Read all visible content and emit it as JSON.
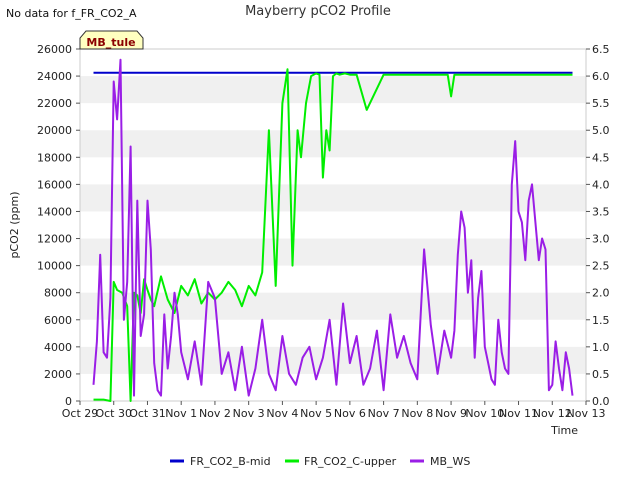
{
  "nodata_text": "No data for f_FR_CO2_A",
  "site_badge": "MB_tule",
  "colors": {
    "band": "#f0f0f0",
    "badge_fill": "#ffffc0",
    "badge_stroke": "#333333",
    "blue": "#0000cc",
    "green": "#00ee00",
    "purple": "#9a1ee6"
  },
  "chart_data": {
    "type": "line",
    "title": "Mayberry pCO2 Profile",
    "xlabel": "Time",
    "ylabel": "pCO2 (ppm)",
    "y2label": "",
    "ylim": [
      0,
      26000
    ],
    "y2lim": [
      0,
      6.5
    ],
    "yticks": [
      0,
      2000,
      4000,
      6000,
      8000,
      10000,
      12000,
      14000,
      16000,
      18000,
      20000,
      22000,
      24000,
      26000
    ],
    "y2ticks": [
      "0.0",
      "0.5",
      "1.0",
      "1.5",
      "2.0",
      "2.5",
      "3.0",
      "3.5",
      "4.0",
      "4.5",
      "5.0",
      "5.5",
      "6.0",
      "6.5"
    ],
    "xlim": [
      0,
      15
    ],
    "xticks": [
      "Oct 29",
      "Oct 30",
      "Oct 31",
      "Nov 1",
      "Nov 2",
      "Nov 3",
      "Nov 4",
      "Nov 5",
      "Nov 6",
      "Nov 7",
      "Nov 8",
      "Nov 9",
      "Nov 10",
      "Nov 11",
      "Nov 12",
      "Nov 13"
    ],
    "grid": "alternating horizontal bands",
    "legend_position": "bottom",
    "series": [
      {
        "name": "FR_CO2_B-mid",
        "axis": "left",
        "color_key": "blue",
        "x": [
          0.4,
          1,
          2,
          3,
          4,
          5,
          6,
          7,
          8,
          9,
          10,
          11,
          12,
          13,
          14,
          14.6
        ],
        "y": [
          24250,
          24250,
          24250,
          24250,
          24250,
          24250,
          24250,
          24250,
          24250,
          24250,
          24250,
          24250,
          24250,
          24250,
          24250,
          24250
        ]
      },
      {
        "name": "FR_CO2_C-upper",
        "axis": "left",
        "color_key": "green",
        "x": [
          0.4,
          0.7,
          0.9,
          1.0,
          1.1,
          1.25,
          1.4,
          1.5,
          1.6,
          1.7,
          1.8,
          1.9,
          2.0,
          2.1,
          2.2,
          2.4,
          2.6,
          2.8,
          3.0,
          3.2,
          3.4,
          3.6,
          3.8,
          4.0,
          4.2,
          4.4,
          4.6,
          4.8,
          5.0,
          5.2,
          5.4,
          5.6,
          5.8,
          6.0,
          6.15,
          6.3,
          6.45,
          6.55,
          6.7,
          6.85,
          7.0,
          7.1,
          7.2,
          7.3,
          7.4,
          7.5,
          7.6,
          7.7,
          7.85,
          8.0,
          8.2,
          8.5,
          9.0,
          9.5,
          10.0,
          10.5,
          10.9,
          11.0,
          11.1,
          11.3,
          11.5,
          12.0,
          12.5,
          13.0,
          13.5,
          14.0,
          14.6
        ],
        "y": [
          100,
          100,
          0,
          8800,
          8200,
          8000,
          7000,
          0,
          8000,
          7800,
          6500,
          9000,
          8200,
          7500,
          7000,
          9200,
          7500,
          6500,
          8500,
          7800,
          9000,
          7200,
          8000,
          7500,
          8000,
          8800,
          8200,
          7000,
          8500,
          7800,
          9500,
          20000,
          8500,
          22000,
          24500,
          10000,
          20000,
          18000,
          22000,
          24000,
          24200,
          24100,
          16500,
          20000,
          18500,
          24000,
          24200,
          24100,
          24200,
          24100,
          24100,
          21500,
          24100,
          24100,
          24100,
          24100,
          24100,
          22500,
          24100,
          24100,
          24100,
          24100,
          24100,
          24100,
          24100,
          24100,
          24100
        ]
      },
      {
        "name": "MB_WS",
        "axis": "right",
        "color_key": "purple",
        "x": [
          0.4,
          0.5,
          0.6,
          0.7,
          0.8,
          0.9,
          1.0,
          1.1,
          1.2,
          1.3,
          1.4,
          1.5,
          1.6,
          1.7,
          1.8,
          1.9,
          2.0,
          2.1,
          2.2,
          2.3,
          2.4,
          2.5,
          2.6,
          2.7,
          2.8,
          2.9,
          3.0,
          3.2,
          3.4,
          3.6,
          3.8,
          4.0,
          4.2,
          4.4,
          4.6,
          4.8,
          5.0,
          5.2,
          5.4,
          5.6,
          5.8,
          6.0,
          6.2,
          6.4,
          6.6,
          6.8,
          7.0,
          7.2,
          7.4,
          7.6,
          7.8,
          8.0,
          8.2,
          8.4,
          8.6,
          8.8,
          9.0,
          9.2,
          9.4,
          9.6,
          9.8,
          10.0,
          10.2,
          10.4,
          10.6,
          10.8,
          11.0,
          11.1,
          11.2,
          11.3,
          11.4,
          11.5,
          11.6,
          11.7,
          11.8,
          11.9,
          12.0,
          12.1,
          12.2,
          12.3,
          12.4,
          12.5,
          12.6,
          12.7,
          12.8,
          12.9,
          13.0,
          13.1,
          13.2,
          13.3,
          13.4,
          13.5,
          13.6,
          13.7,
          13.8,
          13.9,
          14.0,
          14.1,
          14.2,
          14.3,
          14.4,
          14.5,
          14.6
        ],
        "y": [
          0.3,
          1.1,
          2.7,
          0.9,
          0.8,
          1.9,
          5.9,
          5.2,
          6.3,
          1.5,
          2.2,
          4.7,
          0.1,
          3.7,
          1.2,
          1.6,
          3.7,
          2.8,
          0.7,
          0.2,
          0.1,
          1.6,
          0.6,
          1.2,
          2.0,
          1.6,
          0.9,
          0.4,
          1.1,
          0.3,
          2.2,
          1.9,
          0.5,
          0.9,
          0.2,
          1.0,
          0.1,
          0.6,
          1.5,
          0.5,
          0.2,
          1.2,
          0.5,
          0.3,
          0.8,
          1.0,
          0.4,
          0.8,
          1.5,
          0.3,
          1.8,
          0.7,
          1.2,
          0.3,
          0.6,
          1.3,
          0.2,
          1.6,
          0.8,
          1.2,
          0.7,
          0.4,
          2.8,
          1.4,
          0.5,
          1.3,
          0.8,
          1.3,
          2.7,
          3.5,
          3.2,
          2.0,
          2.6,
          0.8,
          1.9,
          2.4,
          1.0,
          0.7,
          0.4,
          0.3,
          1.5,
          0.9,
          0.6,
          0.5,
          4.0,
          4.8,
          3.5,
          3.3,
          2.6,
          3.7,
          4.0,
          3.3,
          2.6,
          3.0,
          2.8,
          0.2,
          0.3,
          1.1,
          0.6,
          0.2,
          0.9,
          0.6,
          0.1
        ]
      }
    ]
  }
}
